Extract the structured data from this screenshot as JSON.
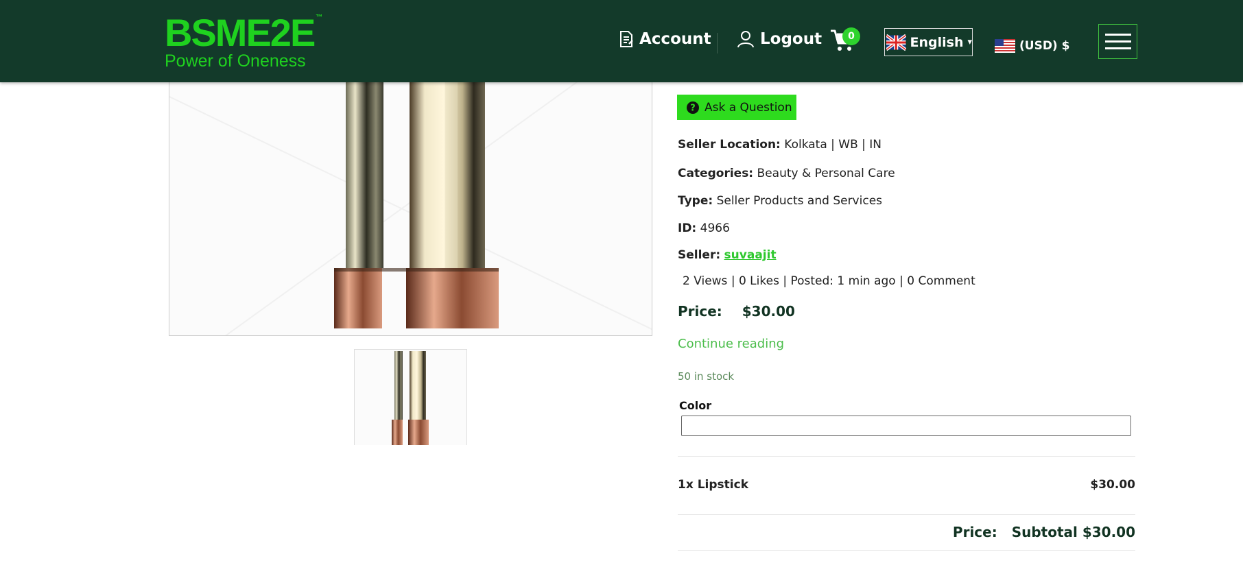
{
  "header": {
    "logo_main": "BSME2E",
    "logo_tm": "™",
    "logo_tagline": "Power of Oneness",
    "account_label": "Account",
    "logout_label": "Logout",
    "cart_count": "0",
    "language_label": "English",
    "language_caret": "▾",
    "currency_label": "(USD) $"
  },
  "product": {
    "ask_question_label": "Ask a Question",
    "seller_location_key": "Seller Location:",
    "seller_location_value": "Kolkata | WB | IN",
    "categories_key": "Categories:",
    "categories_value": "Beauty & Personal Care",
    "type_key": "Type:",
    "type_value": "Seller Products and Services",
    "id_key": "ID:",
    "id_value": "4966",
    "seller_key": "Seller:",
    "seller_value": "suvaajit",
    "stats": "2 Views |  0 Likes |  Posted: 1 min ago |  0 Comment",
    "price_key": "Price:",
    "price_value": "$30.00",
    "continue_label": "Continue reading",
    "stock_text": "50 in stock",
    "color_label": "Color"
  },
  "summary": {
    "item_name": "1x Lipstick",
    "item_price": "$30.00",
    "subtotal_label": "Price:",
    "subtotal_value": "Subtotal $30.00"
  },
  "colors": {
    "header_bg": "#133a2a",
    "brand_green": "#1fd11f",
    "button_green": "#2edb1e"
  }
}
